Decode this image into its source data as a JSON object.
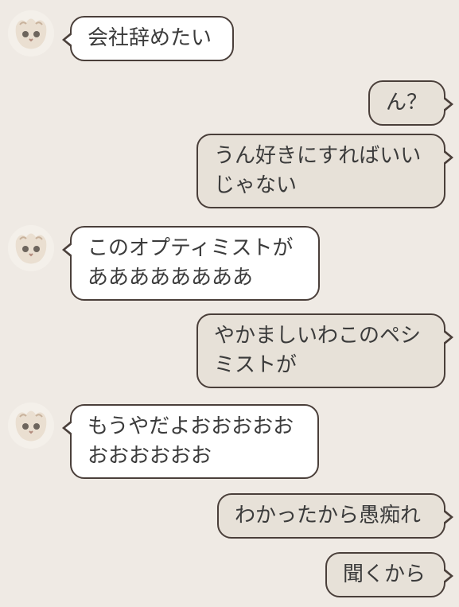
{
  "messages": [
    {
      "side": "in",
      "text": "会社辞めたい",
      "avatar": "cat-avatar"
    },
    {
      "side": "out",
      "text": "ん？"
    },
    {
      "side": "out",
      "text": "うん好きにすればいい\nじゃない"
    },
    {
      "side": "in",
      "text": "このオプティミストが\nああああああああ",
      "avatar": "cat-avatar"
    },
    {
      "side": "out",
      "text": "やかましいわこのペシ\nミストが"
    },
    {
      "side": "in",
      "text": "もうやだよおおおおお\nおおおおおお",
      "avatar": "cat-avatar"
    },
    {
      "side": "out",
      "text": "わかったから愚痴れ"
    },
    {
      "side": "out",
      "text": "聞くから"
    }
  ],
  "colors": {
    "background": "#efeae4",
    "incoming_bubble": "#ffffff",
    "outgoing_bubble": "#e7e1d8",
    "bubble_border": "#4a3f3a",
    "text": "#3b3b3b"
  }
}
